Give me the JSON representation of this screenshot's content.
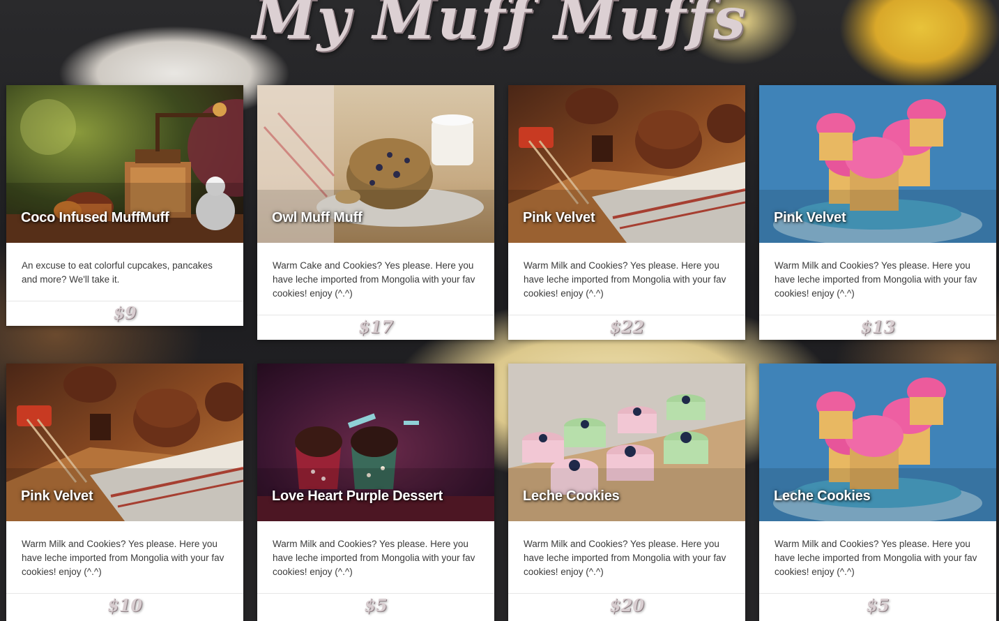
{
  "site": {
    "title": "My Muff Muffs"
  },
  "cards": [
    {
      "title": "Coco Infused MuffMuff",
      "description": "An excuse to eat colorful cupcakes, pancakes and more? We'll take it.",
      "price": "$9",
      "image": "coffee-grinder-muffin-photo"
    },
    {
      "title": "Owl Muff Muff",
      "description": "Warm Cake and Cookies? Yes please. Here you have leche imported from Mongolia with your fav cookies! enjoy (^.^)",
      "price": "$17",
      "image": "blueberry-muffin-teacup-photo"
    },
    {
      "title": "Pink Velvet",
      "description": "Warm Milk and Cookies? Yes please. Here you have leche imported from Mongolia with your fav cookies! enjoy (^.^)",
      "price": "$22",
      "image": "chocolate-muffins-cinnamon-photo"
    },
    {
      "title": "Pink Velvet",
      "description": "Warm Milk and Cookies? Yes please. Here you have leche imported from Mongolia with your fav cookies! enjoy (^.^)",
      "price": "$13",
      "image": "pink-frosted-cupcakes-photo"
    },
    {
      "title": "Pink Velvet",
      "description": "Warm Milk and Cookies? Yes please. Here you have leche imported from Mongolia with your fav cookies! enjoy (^.^)",
      "price": "$10",
      "image": "chocolate-muffins-cinnamon-photo"
    },
    {
      "title": "Love Heart Purple Dessert",
      "description": "Warm Milk and Cookies? Yes please. Here you have leche imported from Mongolia with your fav cookies! enjoy (^.^)",
      "price": "$5",
      "image": "chocolate-cupcakes-purple-photo"
    },
    {
      "title": "Leche Cookies",
      "description": "Warm Milk and Cookies? Yes please. Here you have leche imported from Mongolia with your fav cookies! enjoy (^.^)",
      "price": "$20",
      "image": "blueberry-tarts-tray-photo"
    },
    {
      "title": "Leche Cookies",
      "description": "Warm Milk and Cookies? Yes please. Here you have leche imported from Mongolia with your fav cookies! enjoy (^.^)",
      "price": "$5",
      "image": "pink-frosted-cupcakes-photo"
    }
  ]
}
